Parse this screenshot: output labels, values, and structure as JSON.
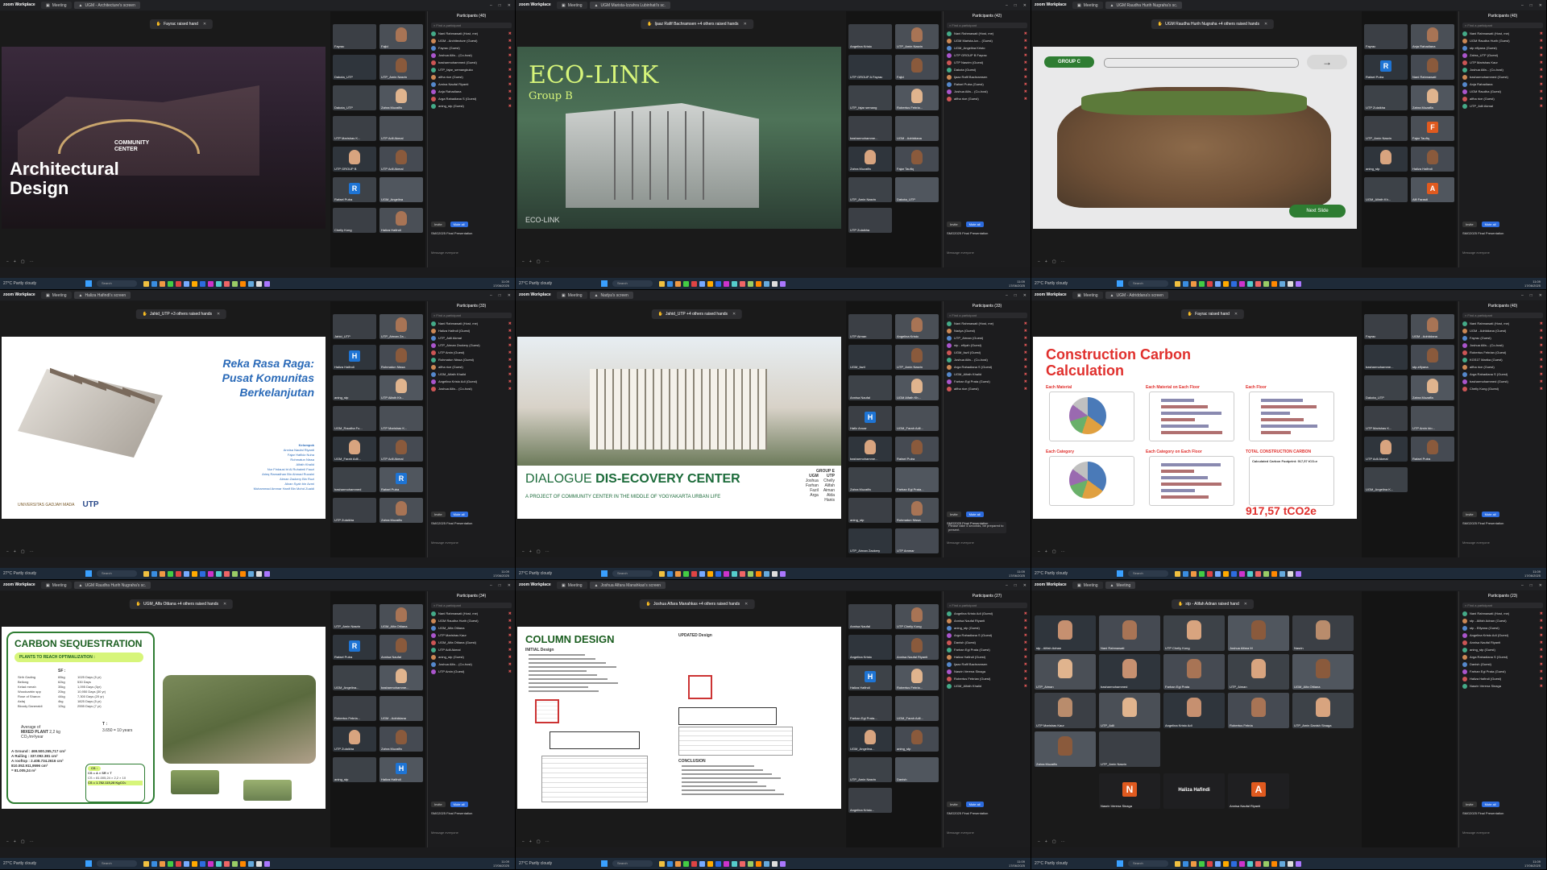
{
  "panes": [
    {
      "tab": "UGM - Architecture's screen",
      "hands": "Fayrac raised hand",
      "slide": {
        "title_lines": [
          "Architectural",
          "Design"
        ],
        "sign_lines": [
          "COMMUNITY",
          "CENTER"
        ]
      },
      "thumbs": [
        "Fayrac",
        "Fajid",
        "Dakota_UTP",
        "UTP_Amin Nasrin",
        "Dakota_UTP",
        "Zahra Muzaffa",
        "UTP Marishas K...",
        "UTP Adli Akmal",
        "UTP GROUP B",
        "UTP Adli Akmal",
        "Rafael Putra",
        "UGM_Angelina",
        "Chelly Kong",
        "Haliza Hafindi"
      ],
      "participants": [
        "Nani Rahmawati (Host, me)",
        "UGM - Architecture (Guest)",
        "Fayrac (Guest)",
        "Joshua Alfa... (Co-host)",
        "basharmohammed (Guest)",
        "UTP_fajar_semangkuko",
        "alfha rice (Guest)",
        "Amina Naufal Riyanti",
        "Anja Rahadiana",
        "Arga Rahadiana S (Guest)",
        "aning_stp (Guest)"
      ],
      "count": "Participants (40)"
    },
    {
      "tab": "UGM Marista-Izzahra Lubinhati's sc.",
      "hands": "Ijaaz Rafif Bachramsen +4 others raised hands",
      "slide": {
        "title": "ECO-LINK",
        "subtitle": "Group B",
        "watermark": "ECO-LINK"
      },
      "thumbs": [
        "Angelina Kristo",
        "UTP_Amin Nasrin",
        "UTP GROUP A Fayrac",
        "Fajid",
        "UTP_fajar semang",
        "Robertus Febria...",
        "basharmohamme...",
        "UGM - Adriddana",
        "Zahra Muzaffa",
        "Fajar Taufiq",
        "UTP_Amin Nasrin",
        "Dakota_UTP",
        "UTP Zulaikha"
      ],
      "participants": [
        "Nani Rahmawati (Host, me)",
        "UGM Marista-Izz... (Guest)",
        "UGM_Angelina Kristo",
        "UTP GROUP B Fayrac",
        "UTP Nasrim (Guest)",
        "Dakota (Guest)",
        "Ijaaz Rafif Bachramsen",
        "Rafael Putra (Guest)",
        "Joshua Alfa... (Co-host)",
        "alfha rice (Guest)"
      ],
      "count": "Participants (42)"
    },
    {
      "tab": "UGM Raudha Hurih Nugraha's sc.",
      "hands": "UGM Raudha Hurih Nugraha +4 others raised hands",
      "slide": {
        "group": "GROUP C",
        "next": "Next Slide"
      },
      "thumbs": [
        "Fayrac",
        "Anja Rahadiana",
        "Rafael Putra",
        "Nani Rahmawati",
        "UTP Zulaikha",
        "Zahra Muzaffa",
        "UTP_Amin Nasrin",
        "Fajar Taufiq",
        "aning_stp",
        "Haliza Hafindi",
        "UGM_Alfath Kh...",
        "Alfi Farasti"
      ],
      "participants": [
        "Nani Rahmawati (Host, me)",
        "UGM Raudha Hurih (Guest)",
        "stp elfyana (Guest)",
        "Zahra_UTP (Guest)",
        "UTP Marishas Kaur",
        "Joshua Alfa... (Co-host)",
        "basharmohammed (Guest)",
        "Anja Rahadiana",
        "UGM Raudha (Guest)",
        "alfha rice (Guest)",
        "UTP_Adli Akmal"
      ],
      "count": "Participants (40)"
    },
    {
      "tab": "Haliza Hafindi's screen",
      "hands": "Jahid_UTP +3 others raised hands",
      "slide": {
        "title_lines": [
          "Reka Rasa Raga:",
          "Pusat Komunitas",
          "Berkelanjutan"
        ],
        "members_title": "Kelompok",
        "members": [
          "Annisa Naufal Riyanti",
          "Fajar Hafiidz Nuha",
          "Rohmatun Nissa",
          "Alfath Khalid",
          "Nur Firdausi bt Al Ruhaimil Fauzi",
          "Arieq Ramadhan Bin Ahmad Ruzaini",
          "Airnan Zackery Bin Ruzi",
          "Afzan Syah bin Azmi",
          "Muhammad Ammar Hanif Bin Mohd Zuaidi"
        ],
        "logos": [
          "UNIVERSITAS GADJAH MADA",
          "UTP"
        ]
      },
      "thumbs": [
        "Jahid_UTP",
        "UTP_Airnan Za...",
        "Haliza Hafindi",
        "Rohmatun Nissa",
        "aning_stp",
        "UTP Alfath Kh...",
        "UGM_Raudha Fu...",
        "UTP Marishas K...",
        "UGM_Farah Adli...",
        "UTP Adli Akmal",
        "basharmohammed",
        "Rafael Putra",
        "UTP Zulaikha",
        "Zahra Muzaffa"
      ],
      "participants": [
        "Nani Rahmawati (Host, me)",
        "Haliza Hafindi (Guest)",
        "UTP_Adli Akmal",
        "UTP_Airnan Zackery (Guest)",
        "UTP Amin (Guest)",
        "Rohmatun Nissa (Guest)",
        "alfha rice (Guest)",
        "UGM_Alfath Khalid",
        "Angelina Kristo Adi (Guest)",
        "Joshua Alfa... (Co-host)"
      ],
      "count": "Participants (33)"
    },
    {
      "tab": "Nadya's screen",
      "hands": "Jahid_UTP +4 others raised hands",
      "slide": {
        "title_plain": "DIALOGUE ",
        "title_bold": "DIS-ECOVERY CENTER",
        "subtitle": "A PROJECT OF COMMUNITY CENTER IN THE MIDDLE OF YOGYAKARTA URBAN LIFE",
        "group_label": "GROUP E",
        "col1_head": "UGM",
        "col1": [
          "Joshua",
          "Farhan",
          "Fazil",
          "Arga"
        ],
        "col2_head": "UTP",
        "col2": [
          "Chelly",
          "Alifah",
          "Aiman",
          "Alda",
          "Hanis"
        ]
      },
      "thumbs": [
        "UTP Airnan",
        "Angelina Kristo",
        "UGM_fazil",
        "UTP_Amin Nasrin",
        "Annisa Naufal",
        "UGM Alfath Kh...",
        "Hafiz Anuar",
        "UGM_Farah Adli...",
        "basharmohamme...",
        "Rafael Putra",
        "Zahra Muzaffa",
        "Farhan Egi Prata...",
        "aning_stp",
        "Rohmatun Nissa",
        "UTP_Airnan Zackery",
        "UTP Ammar"
      ],
      "participants": [
        "Nani Rahmawati (Host, me)",
        "Nadya (Guest)",
        "UTP_Airnan (Guest)",
        "stp - elfyah (Guest)",
        "UGM_fazil (Guest)",
        "Joshua Alfa... (Co-host)",
        "Arga Rahadiana S (Guest)",
        "UGM_Alfath Khalid",
        "Farhan Egi Prata (Guest)",
        "alfha rice (Guest)"
      ],
      "count": "Participants (33)",
      "chat": "Please take 4 seconds, be prepared to present."
    },
    {
      "tab": "UGM - Adriddana's screen",
      "hands": "Fayrac raised hand",
      "slide": {
        "title_lines": [
          "Construction Carbon",
          "Calculation"
        ],
        "labels": [
          "Each Material",
          "Each Material on Each Floor",
          "Each Floor",
          "Each Category",
          "Each Category on Each Floor",
          "TOTAL CONSTRUCTION CARBON"
        ],
        "calc": "Calculated Carbon Footprint: 917,57 tCO₂e",
        "total": "917,57 tCO2e"
      },
      "thumbs": [
        "Fayrac",
        "UGM - Adriddana",
        "basharmohamme...",
        "stp-elfyana",
        "Dakota_UTP",
        "Zahra Muzaffa",
        "UTP Marishas K...",
        "UTP Amin Ido...",
        "UTP Adli Akmal",
        "Rafael Putra",
        "UGM_Angelina K..."
      ],
      "participants": [
        "Nani Rahmawati (Host, me)",
        "UGM - Adriddana (Guest)",
        "Fayrac (Guest)",
        "Joshua Alfa... (Co-host)",
        "Robertus Febrian (Guest)",
        "KGS1T Marika (Guest)",
        "alfha rice (Guest)",
        "Arga Rahadiana S (Guest)",
        "basharmohammed (Guest)",
        "Chelly Kong (Guest)"
      ],
      "count": "Participants (40)"
    },
    {
      "tab": "UGM Raudha Hurih Nugraha's sc.",
      "hands": "UGM_Alfa Ottiana +4 others raised hands",
      "slide": {
        "title": "CARBON SEQUESTRATION",
        "box": "PLANTS TO REACH OPTIMALIZATION :",
        "plants": [
          [
            "Sirih Gading",
            "65kg",
            "1025 Days (5 yr)"
          ],
          [
            "Bellong",
            "62kg",
            "530 Days"
          ],
          [
            "Kelad merah",
            "35kg",
            "1,095 Days (3yr)"
          ],
          [
            "Woodcarbin spp",
            "20kg",
            "10,950 Days (30 yr)"
          ],
          [
            "Rose of Sharon",
            "44kg",
            "7,300 Days (20 yr)"
          ],
          [
            "Asfaj",
            "4kg",
            "1825 Days (5 yr)"
          ],
          [
            "Bloody Daneraldi",
            "12kg",
            "2555 Days (7 yr)"
          ]
        ],
        "sf_label": "SF :",
        "t_label": "T :",
        "t_value": "3.650 = 10 years",
        "avg": "Average of",
        "mixed": "MIXED PLANT",
        "mixed_val": "2,2 kg",
        "unit": "CO₂/m²/year",
        "lines": [
          "A Ground : 469.500.265,717 cm²",
          "A Railing : 337.092.381 cm²",
          "A rooftop : 2.408.734.2616 cm²"
        ],
        "sum1": "810.052.911,9596 cm²",
        "sum2": "= 81.005,24 m²",
        "cs": "CS :",
        "cs_formula": "CS = A × SR × T",
        "cs_calc": "CS = 81.005,24 × 2,2 × 10",
        "cs_result": "CS = 1.782.115,28 KgCO₂"
      },
      "thumbs": [
        "UTP_Amin Nasrin",
        "UGM_Alfa Ottiana",
        "Rafael Putra",
        "Annisa Naufal",
        "UGM_Angelina...",
        "basharmohamme...",
        "Robertus Febria...",
        "UGM - Adriddana",
        "UTP Zulaikha",
        "Zahra Muzaffa",
        "aning_stp",
        "Haliza Hafindi"
      ],
      "participants": [
        "Nani Rahmawati (Host, me)",
        "UGM Raudha Hurih (Guest)",
        "UGM_Alfa Ottiana",
        "UTP Marishas Kaur",
        "UGM_Alfa Ottiana (Guest)",
        "UTP Adli Akmal",
        "aning_stp (Guest)",
        "Joshua Alfa... (Co-host)",
        "UTP Amin (Guest)"
      ],
      "count": "Participants (34)"
    },
    {
      "tab": "Joshua Alfara Manahkas's screen",
      "hands": "Joshua Alfara Manahkas +4 others raised hands",
      "slide": {
        "title": "COLUMN DESIGN",
        "initial": "INITIAL Design",
        "updated": "UPDATED Design",
        "conclusion": "CONCLUSION"
      },
      "thumbs": [
        "Annisa Naufal",
        "UTP Chelly Kong",
        "Angelina Kristo",
        "Annisa Naufal Riyanti",
        "Haliza Hafindi",
        "Robertus Febria...",
        "Farhan Egi Prata...",
        "UGM_Farah Adli...",
        "UGM_Angelina...",
        "aning_stp",
        "UTP_Amin Nasrin",
        "Danish",
        "Angelina Kristo..."
      ],
      "participants": [
        "Angelina Kristo Adi (Guest)",
        "Annisa Naufal Riyanti",
        "aning_stp (Guest)",
        "Arga Rahadiana S (Guest)",
        "Danish (Guest)",
        "Farhan Egi Prata (Guest)",
        "Haliza Hafindi (Guest)",
        "Ijaaz Rafif Bachramsen",
        "Nasrin Verena Sinaga",
        "Robertus Febrian (Guest)",
        "UGM_Alfath Khalid"
      ],
      "count": "Participants (27)"
    },
    {
      "tab": "Meeting",
      "hands": "stp - Alifah Adnan raised hand",
      "gallery": [
        "stp - Alifah Adnan",
        "Nani Rahmawati",
        "UTP Chelly Kong",
        "Joshua Alfara M",
        "Nasrin",
        "UTP_Aiman",
        "basharmohammed",
        "Farhan Egi Prata",
        "UTP_Aiman",
        "UGM_Alfa Ottiana",
        "UTP Marishas Kaur",
        "UTP_Adli",
        "Angelina Kristo Adi",
        "Robertus Febria",
        "UTP_Amin Danish Sinaga",
        "Zahra Muzaffa",
        "UTP_Amin Nasrin"
      ],
      "tiles": [
        {
          "name": "Nasrin Verena Sinaga",
          "letter": "N"
        },
        {
          "name": "Haliza Hafindi",
          "letter": ""
        },
        {
          "name": "Annisa Naufal Riyanti",
          "letter": "A"
        }
      ],
      "participants": [
        "Nani Rahmawati (Host, me)",
        "stp - Alifah Adnan (Guest)",
        "stp - Elfyana (Guest)",
        "Angelina Kristo Adi (Guest)",
        "Annisa Naufal Riyanti",
        "aning_stp (Guest)",
        "Arga Rahadiana S (Guest)",
        "Danish (Guest)",
        "Farhan Egi Prata (Guest)",
        "Haliza Hafindi (Guest)",
        "Nasrin Verena Sinaga"
      ],
      "count": "Participants (23)"
    }
  ],
  "common": {
    "app_name": "zoom Workplace",
    "meeting_tab": "Meeting",
    "search": "Find a participant",
    "btn_invite": "Invite",
    "btn_mute_all": "Mute all",
    "chat_room": "SMG2025 Final Presentation",
    "chat_placeholder": "Message everyone",
    "weather": "27°C Partly cloudy",
    "taskbar_search": "Search",
    "time": "11:09",
    "date": "17/06/2025"
  },
  "colors": {
    "accent": "#2d6cdf",
    "raise_hand": "#f7c948",
    "avatar_blue": "#1e74d4",
    "avatar_orange": "#e05a1f",
    "green": "#2e7d32",
    "carbon_red": "#e0302d",
    "reka_blue": "#2a6ab8"
  }
}
